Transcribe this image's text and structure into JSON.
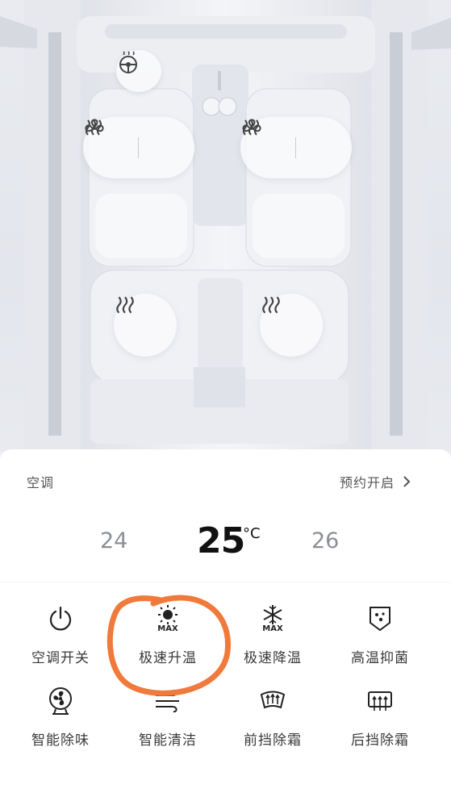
{
  "climate": {
    "title": "空调",
    "schedule_label": "预约开启",
    "temp_low": "24",
    "temp_current": "25",
    "temp_unit": "°C",
    "temp_high": "26"
  },
  "functions": [
    {
      "label": "空调开关",
      "icon": "power-icon"
    },
    {
      "label": "极速升温",
      "icon": "sun-max-icon",
      "max_badge": "MAX"
    },
    {
      "label": "极速降温",
      "icon": "snowflake-max-icon",
      "max_badge": "MAX"
    },
    {
      "label": "高温抑菌",
      "icon": "shield-sterilize-icon"
    },
    {
      "label": "智能除味",
      "icon": "fan-icon"
    },
    {
      "label": "智能清洁",
      "icon": "wind-icon"
    },
    {
      "label": "前挡除霜",
      "icon": "front-defrost-icon"
    },
    {
      "label": "后挡除霜",
      "icon": "rear-defrost-icon"
    }
  ],
  "colors": {
    "annotation": "#ef7a3c",
    "accent_text": "#111111",
    "secondary_text": "#8b8f96"
  }
}
